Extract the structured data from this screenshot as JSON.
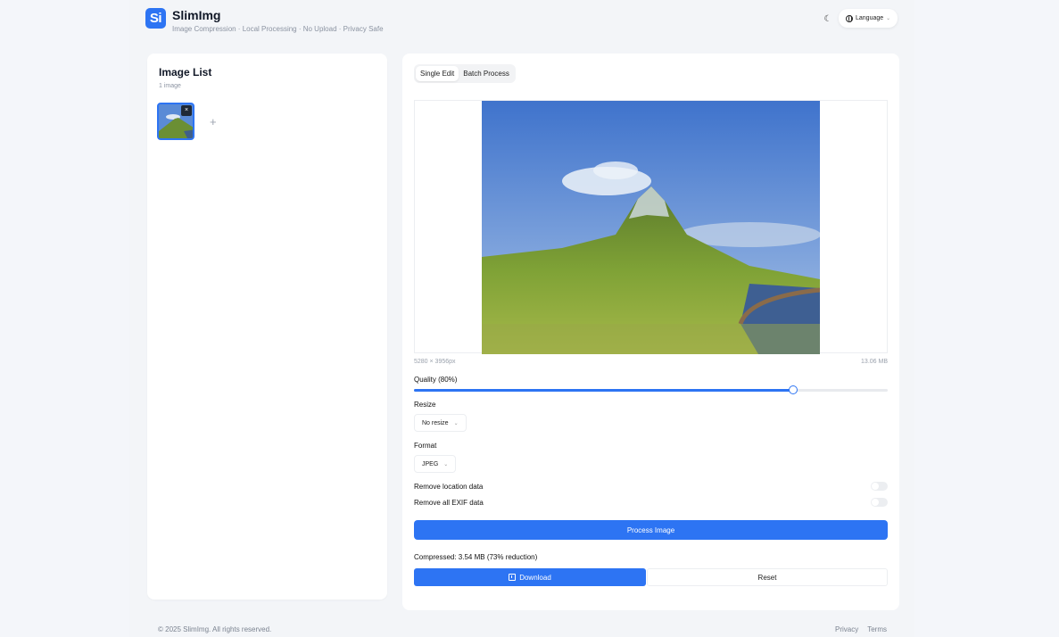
{
  "header": {
    "logo_text": "Si",
    "app_name": "SlimImg",
    "tagline": "Image Compression · Local Processing · No Upload · Privacy Safe",
    "language_label": "Language"
  },
  "image_list": {
    "title": "Image List",
    "count": "1 image",
    "add_symbol": "+",
    "remove_symbol": "×"
  },
  "editor": {
    "tabs": [
      {
        "label": "Single Edit",
        "active": true
      },
      {
        "label": "Batch Process",
        "active": false
      }
    ],
    "dimensions": "5280 × 3956px",
    "file_size": "13.06 MB",
    "quality_label": "Quality (80%)",
    "quality_value": 0.8,
    "resize_label": "Resize",
    "resize_value": "No resize",
    "format_label": "Format",
    "format_value": "JPEG",
    "toggles": [
      {
        "label": "Remove location data",
        "on": false
      },
      {
        "label": "Remove all EXIF data",
        "on": false
      }
    ],
    "process_button": "Process Image",
    "compressed_text": "Compressed: 3.54 MB (73% reduction)",
    "download_button": "Download",
    "reset_button": "Reset"
  },
  "footer": {
    "copyright": "© 2025 SlimImg. All rights reserved.",
    "privacy": "Privacy",
    "terms": "Terms"
  },
  "colors": {
    "accent": "#2d74f3",
    "background": "#f4f6fa"
  }
}
